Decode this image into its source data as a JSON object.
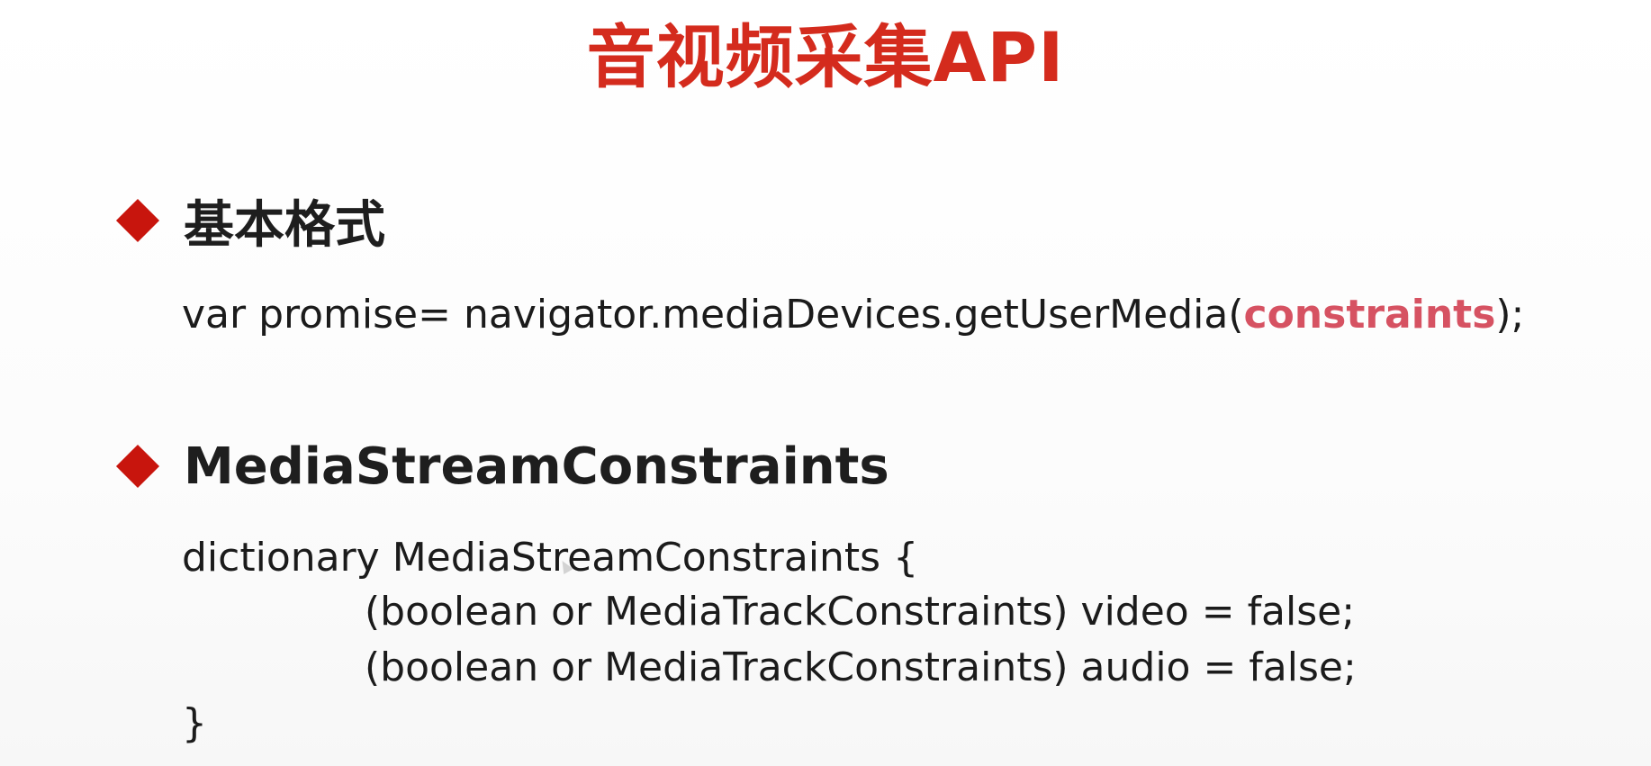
{
  "slide": {
    "title": "音视频采集API",
    "sections": [
      {
        "heading": "基本格式",
        "code": {
          "prefix": "var promise= navigator.mediaDevices.getUserMedia(",
          "highlight": "constraints",
          "suffix": ");"
        }
      },
      {
        "heading": "MediaStreamConstraints",
        "lines": [
          "dictionary MediaStreamConstraints {",
          "(boolean or MediaTrackConstraints) video = false;",
          "(boolean or MediaTrackConstraints) audio = false;",
          "}"
        ]
      }
    ]
  },
  "colors": {
    "title": "#d42b1d",
    "bullet": "#c8150d",
    "highlight": "#d65262",
    "text": "#1b1b1b"
  },
  "icons": {
    "bullet": "diamond-icon",
    "cursor": "mouse-cursor-icon"
  }
}
